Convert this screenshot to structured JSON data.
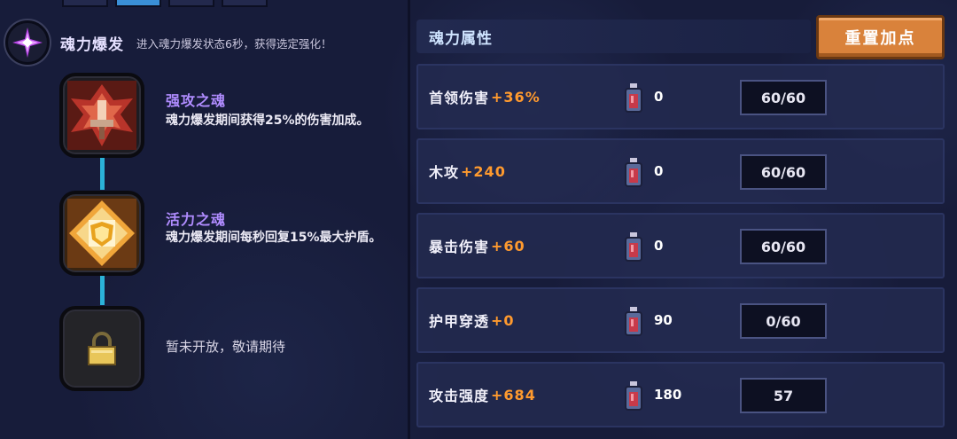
{
  "tabs": [
    {
      "name": "tab-1",
      "active": false
    },
    {
      "name": "tab-2",
      "active": true
    },
    {
      "name": "tab-3",
      "active": false
    },
    {
      "name": "tab-4",
      "active": false
    }
  ],
  "burst": {
    "title": "魂力爆发",
    "description": "进入魂力爆发状态6秒，获得选定强化！",
    "icon": "soul-burst-crystal-icon"
  },
  "runes": [
    {
      "name": "强攻之魂",
      "description": "魂力爆发期间获得25%的伤害加成。",
      "icon": "attack-soul-icon",
      "color": "#c8442c"
    },
    {
      "name": "活力之魂",
      "description": "魂力爆发期间每秒回复15%最大护盾。",
      "icon": "vitality-soul-icon",
      "color": "#f0a63a"
    },
    {
      "name": "",
      "description": "暂未开放，敬请期待",
      "icon": "lock-icon",
      "locked": true
    }
  ],
  "attributes": {
    "header": "魂力属性",
    "reset_label": "重置加点",
    "rows": [
      {
        "name": "首领伤害",
        "bonus": "+36%",
        "cost": "0",
        "level": "60/60"
      },
      {
        "name": "木攻",
        "bonus": "+240",
        "cost": "0",
        "level": "60/60"
      },
      {
        "name": "暴击伤害",
        "bonus": "+60",
        "cost": "0",
        "level": "60/60"
      },
      {
        "name": "护甲穿透",
        "bonus": "+0",
        "cost": "90",
        "level": "0/60"
      },
      {
        "name": "攻击强度",
        "bonus": "+684",
        "cost": "180",
        "level": "57"
      }
    ]
  },
  "colors": {
    "accent_orange": "#ff9a2e",
    "rune_name_purple": "#b08cff",
    "connector_cyan": "#2bb2d8",
    "reset_button": "#d9823b"
  }
}
